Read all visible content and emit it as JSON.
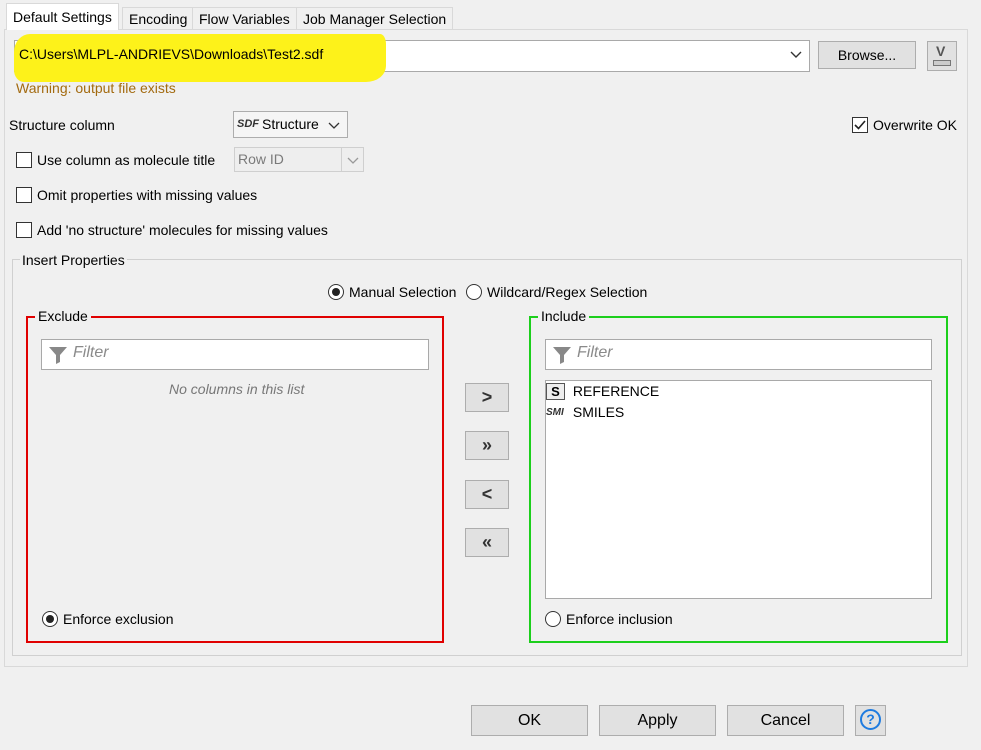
{
  "tabs": [
    {
      "label": "Default Settings",
      "active": true
    },
    {
      "label": "Encoding",
      "active": false
    },
    {
      "label": "Flow Variables",
      "active": false
    },
    {
      "label": "Job Manager Selection",
      "active": false
    }
  ],
  "output": {
    "path": "C:\\Users\\MLPL-ANDRIEVS\\Downloads\\Test2.sdf",
    "browse_label": "Browse...",
    "warning": "Warning: output file exists",
    "flow_var_icon": "V"
  },
  "structure": {
    "label": "Structure column",
    "type_badge": "SDF",
    "value": "Structure",
    "overwrite_label": "Overwrite OK",
    "overwrite_checked": true
  },
  "options": {
    "use_title_label": "Use column as molecule title",
    "title_column": "Row ID",
    "omit_label": "Omit properties with missing values",
    "add_nostructure_label": "Add 'no structure' molecules for missing values"
  },
  "insert": {
    "title": "Insert Properties",
    "manual_label": "Manual Selection",
    "wildcard_label": "Wildcard/Regex Selection",
    "exclude": {
      "title": "Exclude",
      "filter_placeholder": "Filter",
      "empty_text": "No columns in this list",
      "enforce_label": "Enforce exclusion",
      "color": "#e00000"
    },
    "include": {
      "title": "Include",
      "filter_placeholder": "Filter",
      "enforce_label": "Enforce inclusion",
      "color": "#1ccf1c",
      "items": [
        {
          "badge": "S",
          "label": "REFERENCE"
        },
        {
          "badge": "SMI",
          "label": "SMILES"
        }
      ]
    },
    "move_buttons": [
      ">",
      "»",
      "<",
      "«"
    ]
  },
  "footer": {
    "ok": "OK",
    "apply": "Apply",
    "cancel": "Cancel",
    "help": "?"
  }
}
